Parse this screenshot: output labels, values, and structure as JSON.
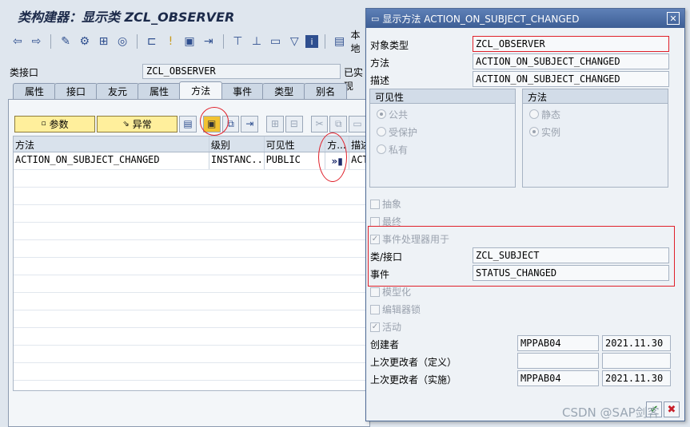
{
  "main": {
    "title": "类构建器：显示类 ZCL_OBSERVER",
    "class_interface_label": "类接口",
    "class_interface_value": "ZCL_OBSERVER",
    "status_fragment": "已实现",
    "toolbar_icons": [
      "back-icon",
      "forward-icon",
      "check-icon",
      "activate-icon",
      "where-used-icon",
      "display-object-icon",
      "hierarchy-icon",
      "info-icon",
      "screen-icon",
      "navigate-icon",
      "package-icon",
      "print-icon",
      "layout-icon",
      "filter-icon",
      "help-info-icon",
      "local-types-icon"
    ],
    "local_button_fragment": "本地",
    "tabs": [
      "属性",
      "接口",
      "友元",
      "属性",
      "方法",
      "事件",
      "类型",
      "别名"
    ],
    "active_tab_index": 4,
    "buttons": {
      "parameters": "参数",
      "exceptions": "异常"
    },
    "grid": {
      "headers": [
        "方法",
        "级别",
        "可见性",
        "方...",
        "描述"
      ],
      "rows": [
        [
          "ACTION_ON_SUBJECT_CHANGED",
          "INSTANC...",
          "PUBLIC",
          "",
          "ACT"
        ]
      ]
    }
  },
  "dialog": {
    "title": "显示方法 ACTION_ON_SUBJECT_CHANGED",
    "object_type_label": "对象类型",
    "object_type_value": "ZCL_OBSERVER",
    "method_label": "方法",
    "method_value": "ACTION_ON_SUBJECT_CHANGED",
    "description_label": "描述",
    "description_value": "ACTION_ON_SUBJECT_CHANGED",
    "visibility": {
      "title": "可见性",
      "options": [
        "公共",
        "受保护",
        "私有"
      ],
      "selected": 0
    },
    "method_kind": {
      "title": "方法",
      "options": [
        "静态",
        "实例"
      ],
      "selected": 1
    },
    "checks": {
      "abstract": "抽象",
      "final": "最终",
      "event_handler": "事件处理器用于",
      "modeled": "模型化",
      "editor_lock": "编辑器锁",
      "active": "活动"
    },
    "event_class_label": "类/接口",
    "event_class_value": "ZCL_SUBJECT",
    "event_label": "事件",
    "event_value": "STATUS_CHANGED",
    "created_by_label": "创建者",
    "created_by_user": "MPPAB04",
    "created_by_date": "2021.11.30",
    "changed_def_label": "上次更改者（定义）",
    "changed_def_user": "",
    "changed_def_date": "",
    "changed_impl_label": "上次更改者（实施）",
    "changed_impl_user": "MPPAB04",
    "changed_impl_date": "2021.11.30"
  },
  "watermark": "CSDN @SAP剑客",
  "colors": {
    "highlight_red": "#e0202a",
    "title_blue": "#3d5e95",
    "button_yellow": "#ffef9c"
  }
}
